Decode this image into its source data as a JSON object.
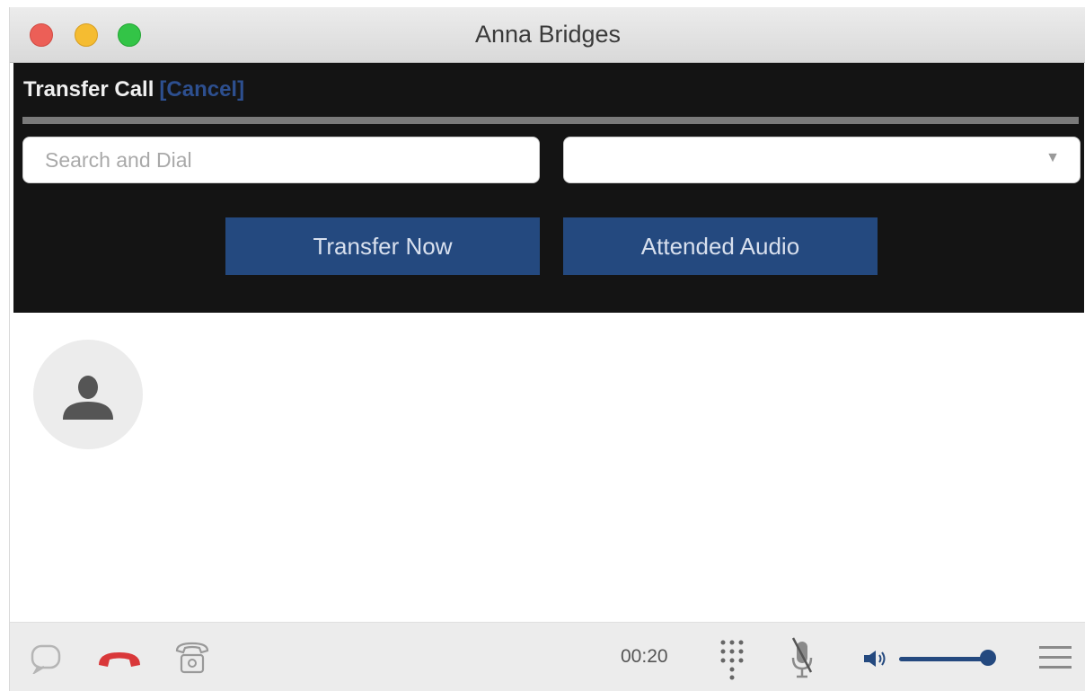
{
  "window": {
    "title": "Anna Bridges"
  },
  "transfer": {
    "heading": "Transfer Call",
    "cancel_label": "[Cancel]",
    "search": {
      "placeholder": "Search and Dial",
      "value": ""
    },
    "line_select": {
      "value": ""
    },
    "transfer_now_label": "Transfer Now",
    "attended_audio_label": "Attended Audio"
  },
  "toolbar": {
    "timer": "00:20",
    "icons": [
      "chat-icon",
      "hangup-icon",
      "phone-icon",
      "dialpad-icon",
      "mute-mic-icon",
      "volume-icon",
      "menu-icon"
    ],
    "volume_level": 1.0
  },
  "colors": {
    "panel_bg": "#141414",
    "button_bg": "#24497f",
    "hangup_red": "#d9383a",
    "cancel_link": "#2d4f8f"
  }
}
